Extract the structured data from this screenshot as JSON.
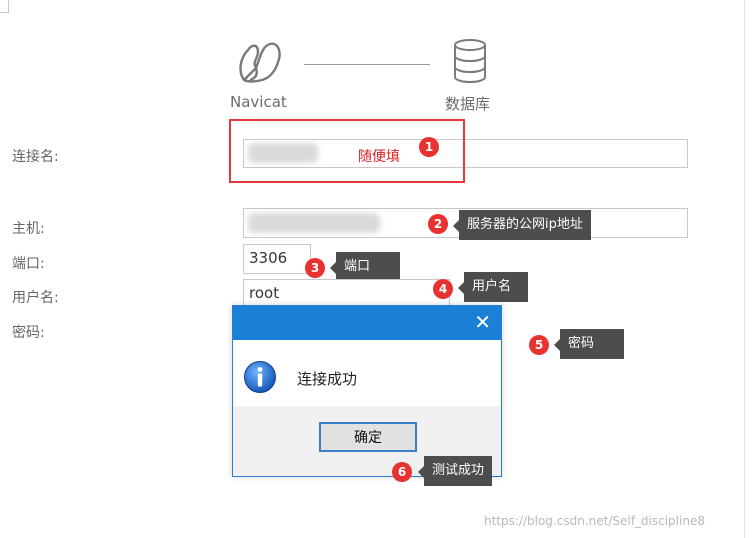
{
  "header": {
    "left_caption": "Navicat",
    "right_caption": "数据库"
  },
  "form": {
    "connection_name_label": "连接名:",
    "host_label": "主机:",
    "port_label": "端口:",
    "user_label": "用户名:",
    "password_label": "密码:",
    "port_value": "3306",
    "user_value": "root"
  },
  "annotations": [
    {
      "number": "1",
      "text": "随便填"
    },
    {
      "number": "2",
      "text": "服务器的公网ip地址"
    },
    {
      "number": "3",
      "text": "端口"
    },
    {
      "number": "4",
      "text": "用户名"
    },
    {
      "number": "5",
      "text": "密码"
    },
    {
      "number": "6",
      "text": "测试成功"
    }
  ],
  "dialog": {
    "message": "连接成功",
    "ok_label": "确定",
    "close_glyph": "✕"
  },
  "watermark": "https://blog.csdn.net/Self_discipline8",
  "colors": {
    "accent_blue": "#1a7fd6",
    "annotation_red": "#e7322f",
    "tag_gray": "#4d4d4d"
  }
}
